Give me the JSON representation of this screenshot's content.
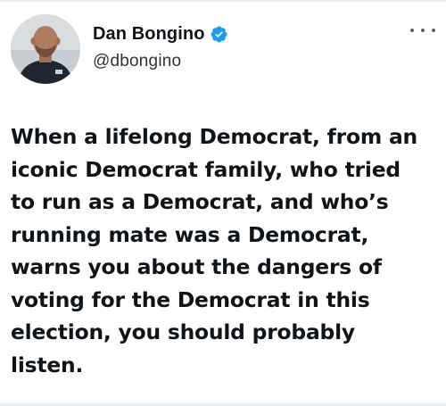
{
  "tweet": {
    "author": {
      "display_name": "Dan Bongino",
      "handle": "@dbongino",
      "verified_icon": "verified-badge-icon",
      "avatar": "avatar-photo"
    },
    "more_icon": "more-options-icon",
    "text_lines": [
      "When a lifelong Democrat, from an",
      "iconic Democrat family, who tried",
      "to run as a Democrat, and who’s",
      "running mate was a Democrat,",
      "warns you about the dangers of",
      "voting for the Democrat in this",
      "election, you should probably",
      "listen."
    ]
  },
  "colors": {
    "text": "#0f1419",
    "handle": "#2f3336",
    "verified": "#1d9bf0",
    "divider": "#e9ecef"
  }
}
